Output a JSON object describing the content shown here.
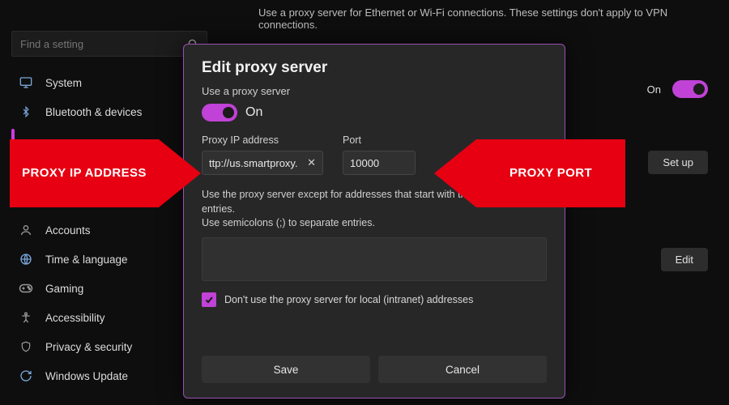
{
  "header": {
    "description": "Use a proxy server for Ethernet or Wi-Fi connections. These settings don't apply to VPN connections."
  },
  "search": {
    "placeholder": "Find a setting"
  },
  "sidebar": {
    "items": [
      {
        "label": "System"
      },
      {
        "label": "Bluetooth & devices"
      },
      {
        "label": "Accounts"
      },
      {
        "label": "Time & language"
      },
      {
        "label": "Gaming"
      },
      {
        "label": "Accessibility"
      },
      {
        "label": "Privacy & security"
      },
      {
        "label": "Windows Update"
      }
    ]
  },
  "right": {
    "on_label": "On",
    "setup_label": "Set up",
    "edit_label": "Edit"
  },
  "dialog": {
    "title": "Edit proxy server",
    "use_label": "Use a proxy server",
    "toggle_state": "On",
    "ip_label": "Proxy IP address",
    "ip_value": "ttp://us.smartproxy.",
    "port_label": "Port",
    "port_value": "10000",
    "except_line1": "Use the proxy server except for addresses that start with the following entries.",
    "except_line2": "Use semicolons (;) to separate entries.",
    "except_value": "",
    "checkbox_label": "Don't use the proxy server for local (intranet) addresses",
    "checkbox_checked": true,
    "save_label": "Save",
    "cancel_label": "Cancel"
  },
  "callouts": {
    "left": "PROXY IP ADDRESS",
    "right": "PROXY PORT"
  },
  "colors": {
    "accent": "#c042d6",
    "callout": "#e60012"
  }
}
